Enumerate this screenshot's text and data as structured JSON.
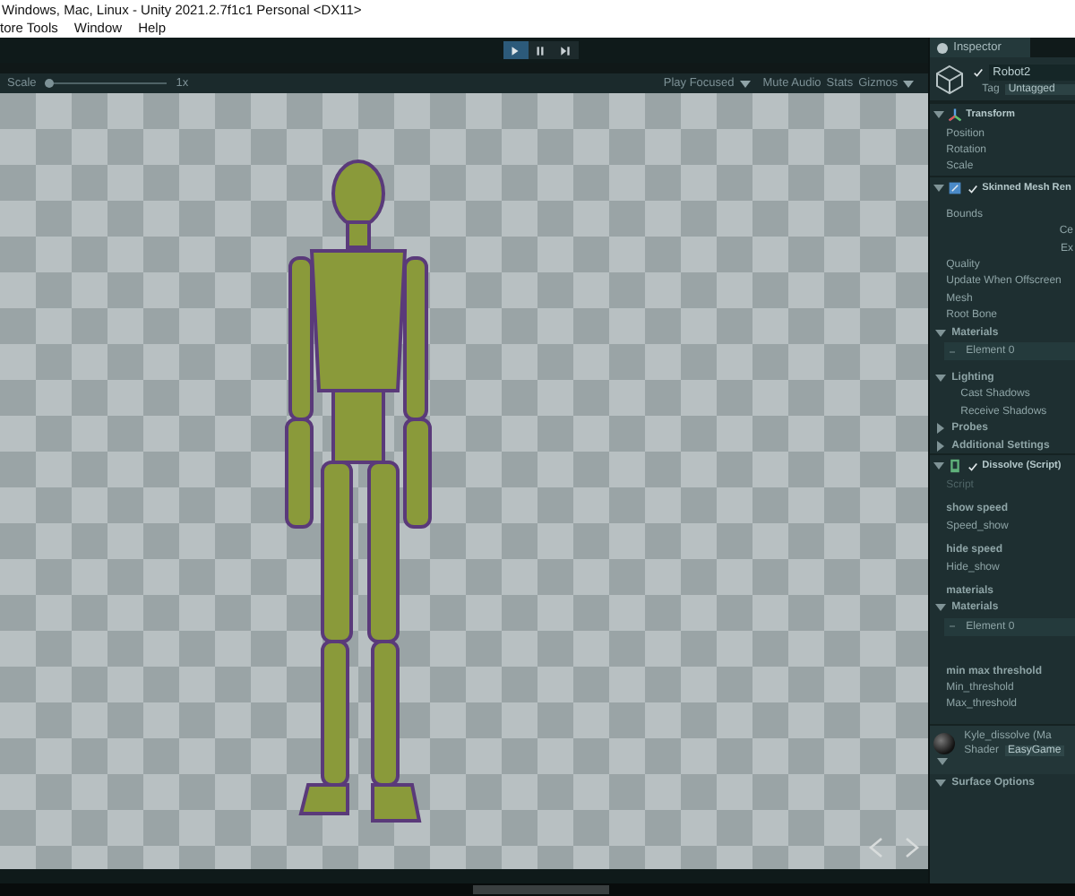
{
  "window": {
    "title": "Windows, Mac, Linux - Unity 2021.2.7f1c1 Personal <DX11>"
  },
  "menu": [
    "tore Tools",
    "Window",
    "Help"
  ],
  "play_controls": [
    {
      "kind": "play",
      "selected": true
    },
    {
      "kind": "pause",
      "selected": false
    },
    {
      "kind": "step",
      "selected": false
    }
  ],
  "scene_toolbar": {
    "scale_label": "Scale",
    "scale": {
      "level": 0.0
    },
    "scale_value": "1x",
    "play_mode": "Play Focused",
    "items": [
      "Mute Audio",
      "Stats",
      "Gizmos"
    ]
  },
  "inspector": {
    "tab": "Inspector",
    "object_name": "Robot2",
    "active": true,
    "tag_label": "Tag",
    "tag": "Untagged",
    "rows": [
      {
        "kind": "component",
        "label": "Transform",
        "expanded": true
      },
      {
        "kind": "field",
        "label": "Position"
      },
      {
        "kind": "field",
        "label": "Rotation"
      },
      {
        "kind": "field",
        "label": "Scale"
      },
      {
        "kind": "component",
        "label": "Skinned Mesh Ren",
        "expanded": true,
        "checked": true
      },
      {
        "kind": "field",
        "label": "Bounds"
      },
      {
        "kind": "value",
        "label": "Ce"
      },
      {
        "kind": "value",
        "label": "Ex"
      },
      {
        "kind": "field",
        "label": "Quality"
      },
      {
        "kind": "field",
        "label": "Update When Offscreen"
      },
      {
        "kind": "field",
        "label": "Mesh"
      },
      {
        "kind": "field",
        "label": "Root Bone"
      },
      {
        "kind": "foldout",
        "label": "Materials",
        "expanded": true
      },
      {
        "kind": "element",
        "label": "Element 0"
      },
      {
        "kind": "foldout",
        "label": "Lighting",
        "expanded": true
      },
      {
        "kind": "subfield",
        "label": "Cast Shadows"
      },
      {
        "kind": "subfield",
        "label": "Receive Shadows"
      },
      {
        "kind": "foldout",
        "label": "Probes",
        "expanded": false
      },
      {
        "kind": "foldout",
        "label": "Additional Settings",
        "expanded": false
      },
      {
        "kind": "component",
        "label": "Dissolve (Script)",
        "expanded": true,
        "checked": true
      },
      {
        "kind": "muted",
        "label": "Script"
      },
      {
        "kind": "header",
        "label": "show speed"
      },
      {
        "kind": "field",
        "label": "Speed_show"
      },
      {
        "kind": "header",
        "label": "hide speed"
      },
      {
        "kind": "field",
        "label": "Hide_show"
      },
      {
        "kind": "header",
        "label": "materials"
      },
      {
        "kind": "foldout",
        "label": "Materials",
        "expanded": true
      },
      {
        "kind": "element",
        "label": "Element 0"
      },
      {
        "kind": "header",
        "label": "min max threshold"
      },
      {
        "kind": "field",
        "label": "Min_threshold"
      },
      {
        "kind": "field",
        "label": "Max_threshold"
      }
    ],
    "material": {
      "name": "Kyle_dissolve (Ma",
      "shader_label": "Shader",
      "shader": "EasyGame",
      "expanded": true
    },
    "material_rows": [
      {
        "kind": "foldout",
        "label": "Surface Options",
        "expanded": true
      }
    ]
  }
}
